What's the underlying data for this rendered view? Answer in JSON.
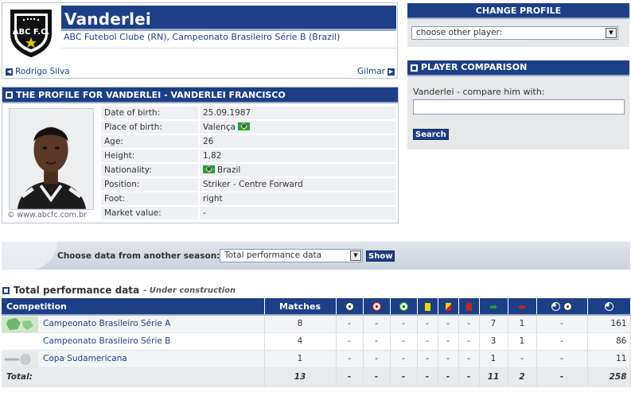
{
  "player": {
    "name": "Vanderlei",
    "club_line": "ABC Futebol Clube (RN), Campeonato Brasileiro Série B (Brazil)",
    "crest_text": "ABC F.C.",
    "prev_player": "Rodrigo Silva",
    "next_player": "Gilmar"
  },
  "change_profile": {
    "title": "CHANGE PROFILE",
    "select_value": "choose other player:"
  },
  "comparison": {
    "title": "PLAYER COMPARISON",
    "label": "Vanderlei - compare him with:",
    "input_value": "",
    "button": "Search"
  },
  "profile": {
    "title": "THE PROFILE FOR VANDERLEI - VANDERLEI FRANCISCO",
    "photo_credit": "© www.abcfc.com.br",
    "facts": [
      {
        "label": "Date of birth:",
        "value": "25.09.1987"
      },
      {
        "label": "Place of birth:",
        "value": "Valença"
      },
      {
        "label": "Age:",
        "value": "26"
      },
      {
        "label": "Height:",
        "value": "1,82"
      },
      {
        "label": "Nationality:",
        "value": "Brazil"
      },
      {
        "label": "Position:",
        "value": "Striker - Centre Forward"
      },
      {
        "label": "Foot:",
        "value": "right"
      },
      {
        "label": "Market value:",
        "value": "-"
      }
    ]
  },
  "season": {
    "label": "Choose data from another season:",
    "select_value": "Total performance data",
    "button": "Show"
  },
  "performance": {
    "title": "Total performance data",
    "subtitle": "- Under construction",
    "headers": {
      "competition": "Competition",
      "matches": "Matches"
    },
    "rows": [
      {
        "competition": "Campeonato Brasileiro Série A",
        "matches": "8",
        "goals": "-",
        "own_goals": "-",
        "assists": "-",
        "yellow": "-",
        "yellow_red": "-",
        "red": "-",
        "subbed_on": "7",
        "subbed_off": "1",
        "ppg": "-",
        "minutes": "161"
      },
      {
        "competition": "Campeonato Brasileiro Série B",
        "matches": "4",
        "goals": "-",
        "own_goals": "-",
        "assists": "-",
        "yellow": "-",
        "yellow_red": "-",
        "red": "-",
        "subbed_on": "3",
        "subbed_off": "1",
        "ppg": "-",
        "minutes": "86"
      },
      {
        "competition": "Copa Sudamericana",
        "matches": "1",
        "goals": "-",
        "own_goals": "-",
        "assists": "-",
        "yellow": "-",
        "yellow_red": "-",
        "red": "-",
        "subbed_on": "1",
        "subbed_off": "-",
        "ppg": "-",
        "minutes": "11"
      }
    ],
    "total": {
      "label": "Total:",
      "matches": "13",
      "goals": "-",
      "own_goals": "-",
      "assists": "-",
      "yellow": "-",
      "yellow_red": "-",
      "red": "-",
      "subbed_on": "11",
      "subbed_off": "2",
      "ppg": "-",
      "minutes": "258"
    }
  },
  "colors": {
    "brand_blue": "#1d3f87",
    "accent_border": "#9aa9c8"
  }
}
